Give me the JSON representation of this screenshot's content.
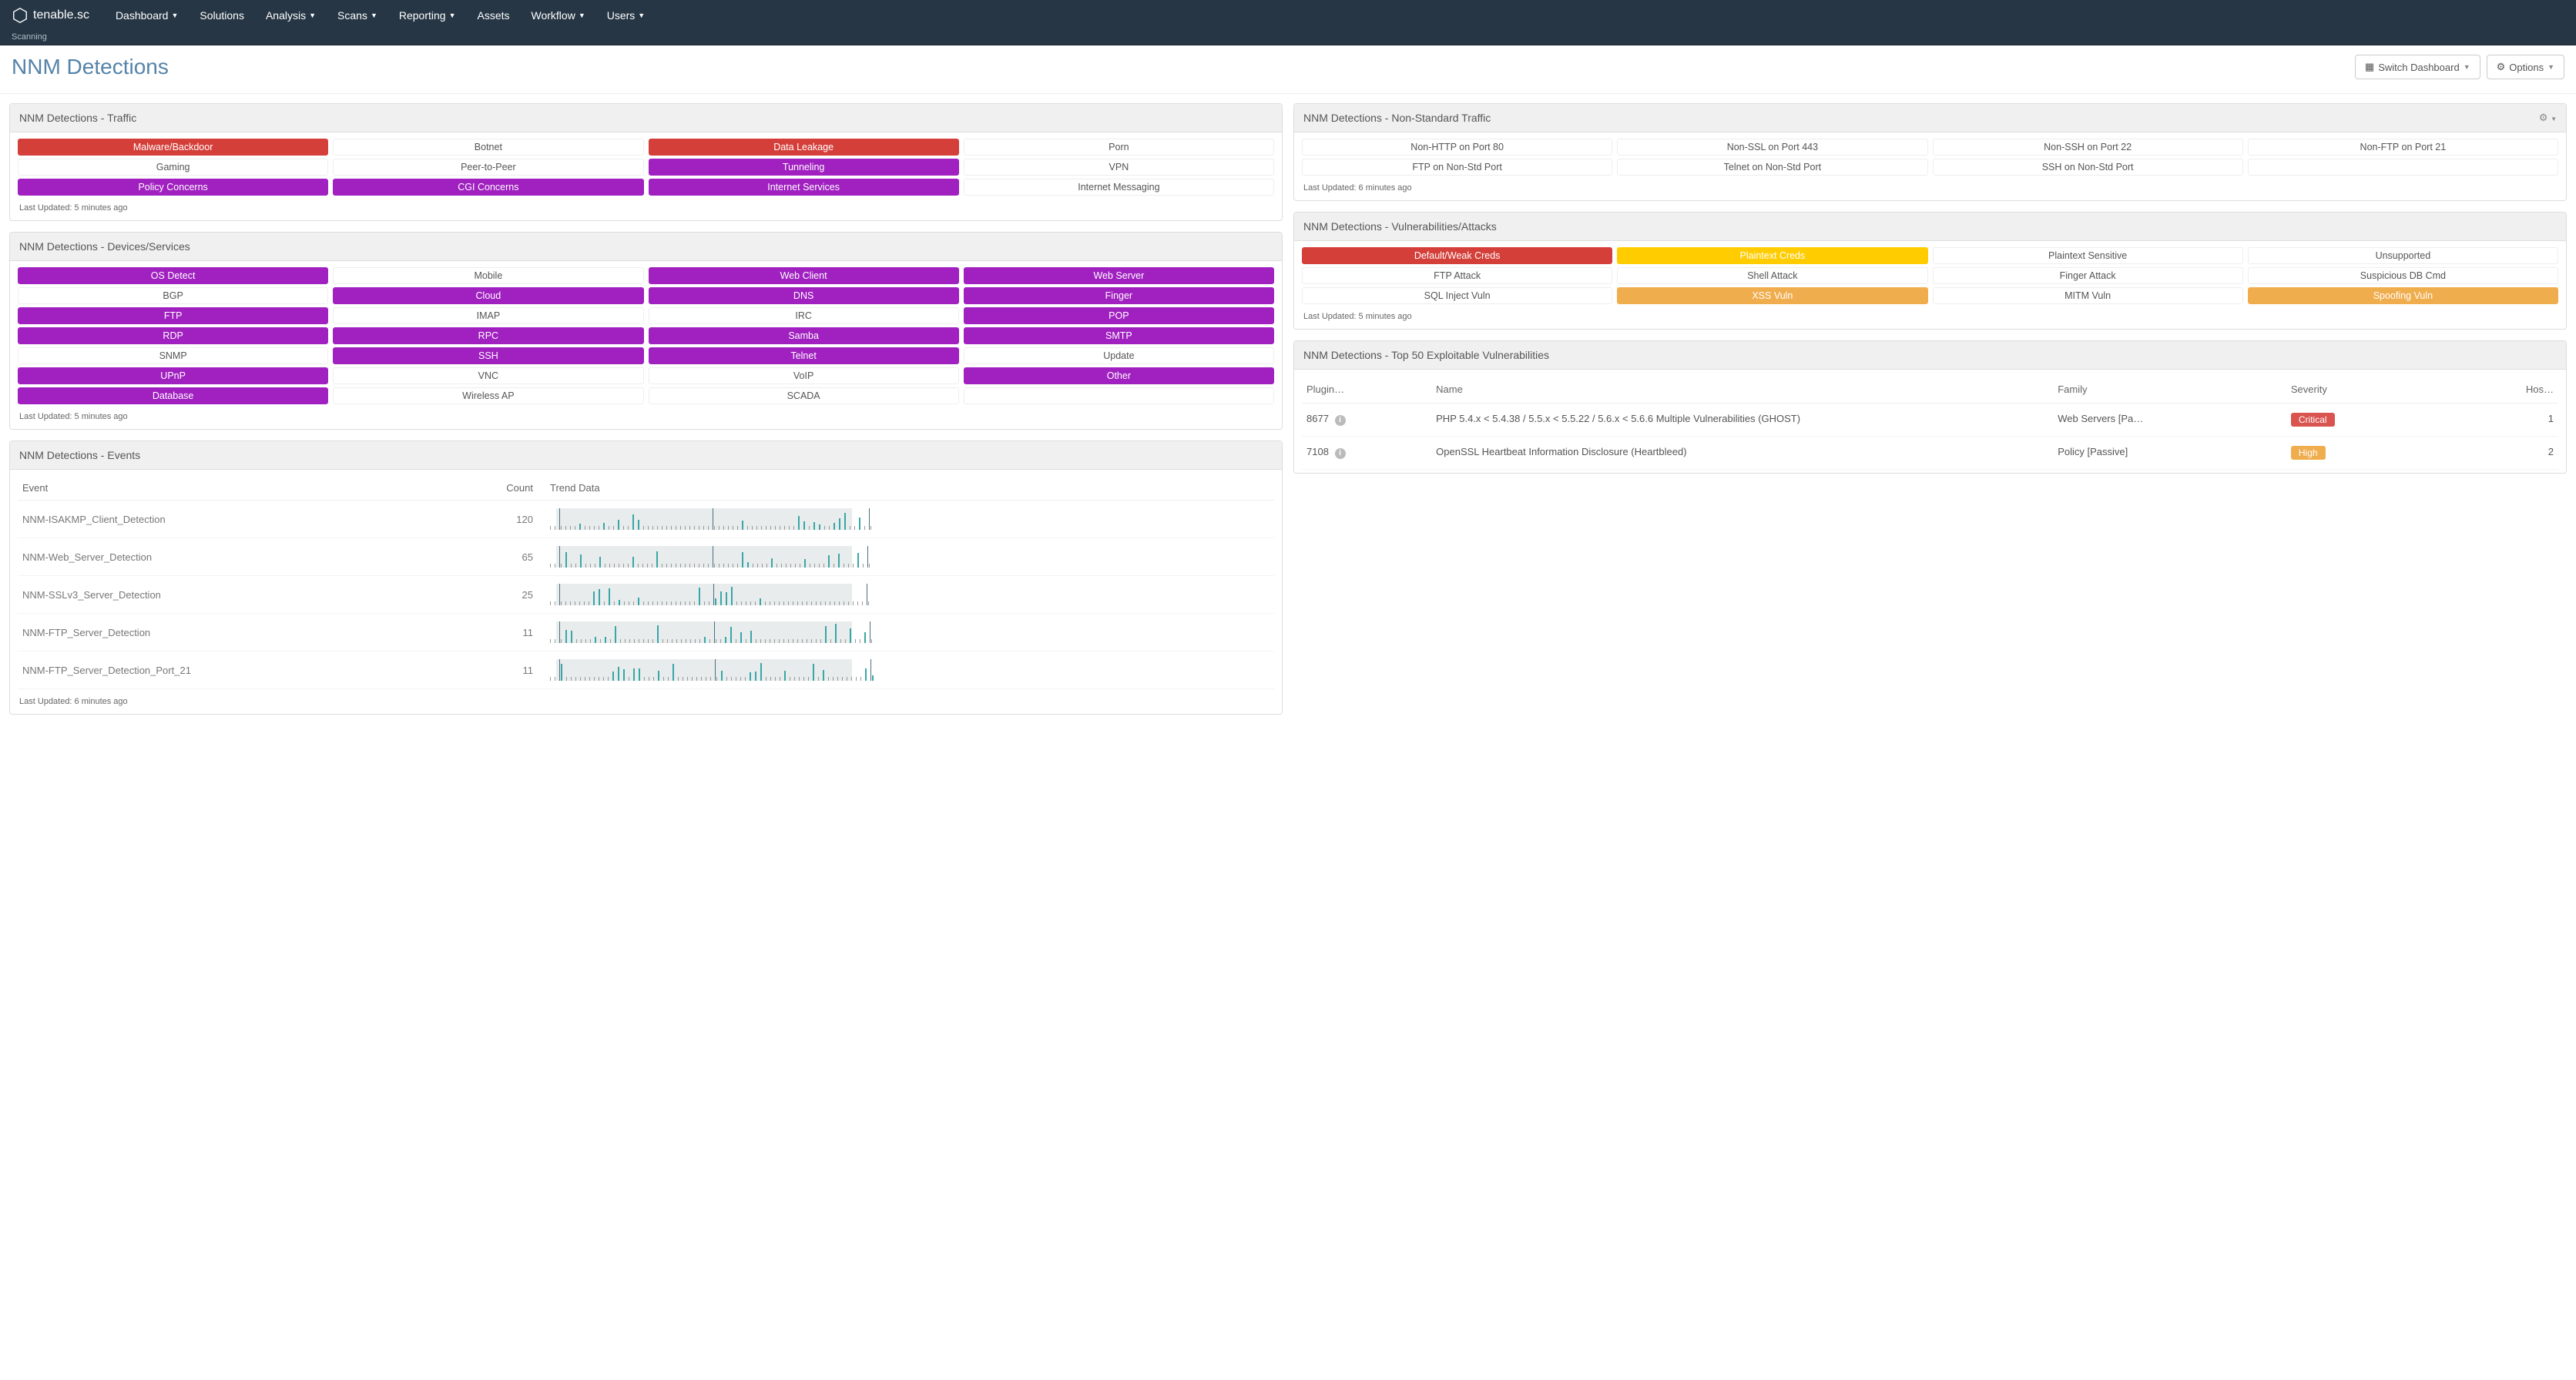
{
  "brand": "tenable.sc",
  "subbar": "Scanning",
  "nav": [
    "Dashboard",
    "Solutions",
    "Analysis",
    "Scans",
    "Reporting",
    "Assets",
    "Workflow",
    "Users"
  ],
  "nav_caret": [
    true,
    false,
    true,
    true,
    true,
    false,
    true,
    true
  ],
  "page_title": "NNM Detections",
  "btn_switch": "Switch Dashboard",
  "btn_options": "Options",
  "panels": {
    "traffic": {
      "title": "NNM Detections - Traffic",
      "updated": "Last Updated: 5 minutes ago",
      "cells": [
        {
          "t": "Malware/Backdoor",
          "c": "red"
        },
        {
          "t": "Botnet",
          "c": "plain"
        },
        {
          "t": "Data Leakage",
          "c": "red"
        },
        {
          "t": "Porn",
          "c": "plain"
        },
        {
          "t": "Gaming",
          "c": "plain"
        },
        {
          "t": "Peer-to-Peer",
          "c": "plain"
        },
        {
          "t": "Tunneling",
          "c": "purple"
        },
        {
          "t": "VPN",
          "c": "plain"
        },
        {
          "t": "Policy Concerns",
          "c": "purple"
        },
        {
          "t": "CGI Concerns",
          "c": "purple"
        },
        {
          "t": "Internet Services",
          "c": "purple"
        },
        {
          "t": "Internet Messaging",
          "c": "plain"
        }
      ]
    },
    "devices": {
      "title": "NNM Detections - Devices/Services",
      "updated": "Last Updated: 5 minutes ago",
      "cells": [
        {
          "t": "OS Detect",
          "c": "purple"
        },
        {
          "t": "Mobile",
          "c": "plain"
        },
        {
          "t": "Web Client",
          "c": "purple"
        },
        {
          "t": "Web Server",
          "c": "purple"
        },
        {
          "t": "BGP",
          "c": "plain"
        },
        {
          "t": "Cloud",
          "c": "purple"
        },
        {
          "t": "DNS",
          "c": "purple"
        },
        {
          "t": "Finger",
          "c": "purple"
        },
        {
          "t": "FTP",
          "c": "purple"
        },
        {
          "t": "IMAP",
          "c": "plain"
        },
        {
          "t": "IRC",
          "c": "plain"
        },
        {
          "t": "POP",
          "c": "purple"
        },
        {
          "t": "RDP",
          "c": "purple"
        },
        {
          "t": "RPC",
          "c": "purple"
        },
        {
          "t": "Samba",
          "c": "purple"
        },
        {
          "t": "SMTP",
          "c": "purple"
        },
        {
          "t": "SNMP",
          "c": "plain"
        },
        {
          "t": "SSH",
          "c": "purple"
        },
        {
          "t": "Telnet",
          "c": "purple"
        },
        {
          "t": "Update",
          "c": "plain"
        },
        {
          "t": "UPnP",
          "c": "purple"
        },
        {
          "t": "VNC",
          "c": "plain"
        },
        {
          "t": "VoIP",
          "c": "plain"
        },
        {
          "t": "Other",
          "c": "purple"
        },
        {
          "t": "Database",
          "c": "purple"
        },
        {
          "t": "Wireless AP",
          "c": "plain"
        },
        {
          "t": "SCADA",
          "c": "plain"
        },
        {
          "t": "",
          "c": "plain"
        }
      ]
    },
    "events": {
      "title": "NNM Detections - Events",
      "updated": "Last Updated: 6 minutes ago",
      "headers": {
        "event": "Event",
        "count": "Count",
        "trend": "Trend Data"
      },
      "rows": [
        {
          "event": "NNM-ISAKMP_Client_Detection",
          "count": "120"
        },
        {
          "event": "NNM-Web_Server_Detection",
          "count": "65"
        },
        {
          "event": "NNM-SSLv3_Server_Detection",
          "count": "25"
        },
        {
          "event": "NNM-FTP_Server_Detection",
          "count": "11"
        },
        {
          "event": "NNM-FTP_Server_Detection_Port_21",
          "count": "11"
        }
      ]
    },
    "nonstd": {
      "title": "NNM Detections - Non-Standard Traffic",
      "updated": "Last Updated: 6 minutes ago",
      "tooltip": "Telnet on Non-Std Port",
      "cells": [
        {
          "t": "Non-HTTP on Port 80",
          "c": "plain"
        },
        {
          "t": "Non-SSL on Port 443",
          "c": "plain"
        },
        {
          "t": "Non-SSH on Port 22",
          "c": "plain"
        },
        {
          "t": "Non-FTP on Port 21",
          "c": "plain"
        },
        {
          "t": "FTP on Non-Std Port",
          "c": "plain"
        },
        {
          "t": "Telnet on Non-Std Port",
          "c": "plain",
          "tip": true
        },
        {
          "t": "SSH on Non-Std Port",
          "c": "plain"
        },
        {
          "t": "",
          "c": "plain"
        }
      ]
    },
    "vulnattacks": {
      "title": "NNM Detections - Vulnerabilities/Attacks",
      "updated": "Last Updated: 5 minutes ago",
      "cells": [
        {
          "t": "Default/Weak Creds",
          "c": "red"
        },
        {
          "t": "Plaintext Creds",
          "c": "yellow"
        },
        {
          "t": "Plaintext Sensitive",
          "c": "plain"
        },
        {
          "t": "Unsupported",
          "c": "plain"
        },
        {
          "t": "FTP Attack",
          "c": "plain"
        },
        {
          "t": "Shell Attack",
          "c": "plain"
        },
        {
          "t": "Finger Attack",
          "c": "plain"
        },
        {
          "t": "Suspicious DB Cmd",
          "c": "plain"
        },
        {
          "t": "SQL Inject Vuln",
          "c": "plain"
        },
        {
          "t": "XSS Vuln",
          "c": "orange"
        },
        {
          "t": "MITM Vuln",
          "c": "plain"
        },
        {
          "t": "Spoofing Vuln",
          "c": "orange"
        }
      ]
    },
    "top50": {
      "title": "NNM Detections - Top 50 Exploitable Vulnerabilities",
      "headers": {
        "plugin": "Plugin…",
        "name": "Name",
        "family": "Family",
        "severity": "Severity",
        "hosts": "Hos…"
      },
      "rows": [
        {
          "plugin": "8677",
          "name": "PHP 5.4.x < 5.4.38 / 5.5.x < 5.5.22 / 5.6.x < 5.6.6 Multiple Vulnerabilities (GHOST)",
          "family": "Web Servers [Pa…",
          "severity": "Critical",
          "sevclass": "critical",
          "hosts": "1"
        },
        {
          "plugin": "7108",
          "name": "OpenSSL Heartbeat Information Disclosure (Heartbleed)",
          "family": "Policy [Passive]",
          "severity": "High",
          "sevclass": "high",
          "hosts": "2"
        }
      ]
    }
  }
}
